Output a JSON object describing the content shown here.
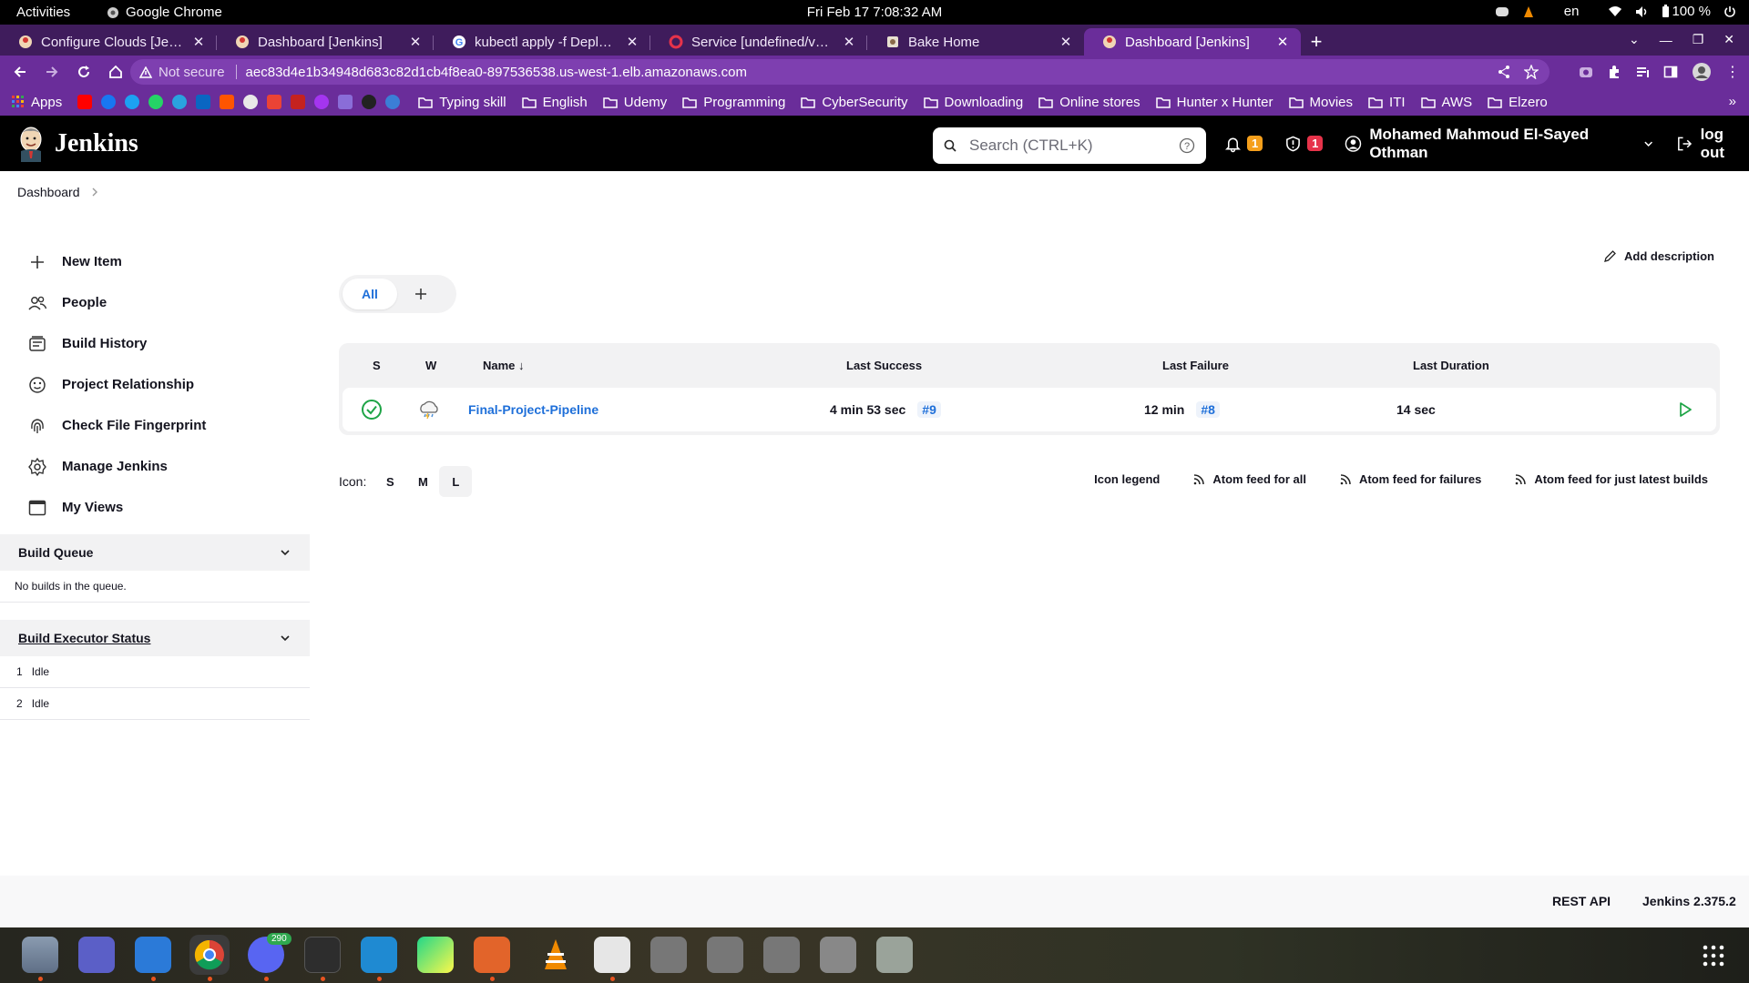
{
  "system": {
    "activities": "Activities",
    "app_name": "Google Chrome",
    "clock": "Fri Feb 17   7:08:32 AM",
    "lang": "en",
    "battery": "100 %"
  },
  "tabs": [
    {
      "label": "Configure Clouds [Jenkins]",
      "active": false
    },
    {
      "label": "Dashboard [Jenkins]",
      "active": false
    },
    {
      "label": "kubectl apply -f Deployment",
      "active": false
    },
    {
      "label": "Service [undefined/v1] - N",
      "active": false
    },
    {
      "label": "Bake Home",
      "active": false
    },
    {
      "label": "Dashboard [Jenkins]",
      "active": true
    }
  ],
  "address": {
    "security": "Not secure",
    "url": "aec83d4e1b34948d683c82d1cb4f8ea0-897536538.us-west-1.elb.amazonaws.com"
  },
  "bookmarks": {
    "apps": "Apps",
    "folders": [
      "Typing skill",
      "English",
      "Udemy",
      "Programming",
      "CyberSecurity",
      "Downloading",
      "Online stores",
      "Hunter x Hunter",
      "Movies",
      "ITI",
      "AWS",
      "Elzero"
    ]
  },
  "jenkins": {
    "brand": "Jenkins",
    "search_placeholder": "Search (CTRL+K)",
    "notifications_count": "1",
    "security_count": "1",
    "user": "Mohamed Mahmoud El-Sayed Othman",
    "logout": "log out"
  },
  "breadcrumb": {
    "root": "Dashboard"
  },
  "sidebar": {
    "items": [
      "New Item",
      "People",
      "Build History",
      "Project Relationship",
      "Check File Fingerprint",
      "Manage Jenkins",
      "My Views"
    ]
  },
  "build_queue": {
    "title": "Build Queue",
    "empty": "No builds in the queue."
  },
  "executors": {
    "title": "Build Executor Status",
    "rows": [
      {
        "num": "1",
        "status": "Idle"
      },
      {
        "num": "2",
        "status": "Idle"
      }
    ]
  },
  "main": {
    "add_description": "Add description",
    "view_tab": "All",
    "columns": {
      "s": "S",
      "w": "W",
      "name": "Name ↓",
      "last_success": "Last Success",
      "last_failure": "Last Failure",
      "last_duration": "Last Duration"
    },
    "job": {
      "name": "Final-Project-Pipeline",
      "last_success": "4 min 53 sec",
      "last_success_build": "#9",
      "last_failure": "12 min",
      "last_failure_build": "#8",
      "last_duration": "14 sec"
    },
    "icon_label": "Icon:",
    "icon_sizes": [
      "S",
      "M",
      "L"
    ],
    "icon_selected": "L",
    "icon_legend": "Icon legend",
    "feeds": [
      "Atom feed for all",
      "Atom feed for failures",
      "Atom feed for just latest builds"
    ]
  },
  "footer": {
    "rest_api": "REST API",
    "version": "Jenkins 2.375.2"
  },
  "dock": {
    "discord_badge": "290"
  },
  "colors": {
    "accent": "#6a2d9a",
    "link": "#1e6fd9",
    "success": "#1ea446"
  }
}
